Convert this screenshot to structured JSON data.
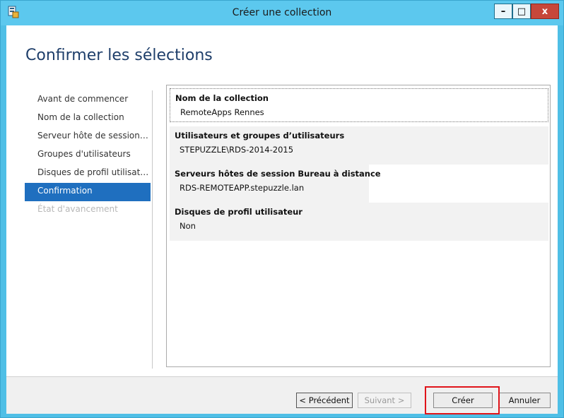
{
  "window": {
    "title": "Créer une collection",
    "minimize_glyph": "–",
    "maximize_glyph": "□",
    "close_glyph": "x",
    "accent_color": "#5cc8ee"
  },
  "page": {
    "title": "Confirmer les sélections"
  },
  "nav": {
    "items": [
      {
        "label": "Avant de commencer",
        "state": "normal"
      },
      {
        "label": "Nom de la collection",
        "state": "normal"
      },
      {
        "label": "Serveur hôte de session Bureau à distance",
        "state": "normal"
      },
      {
        "label": "Groupes d'utilisateurs",
        "state": "normal"
      },
      {
        "label": "Disques de profil utilisateur",
        "state": "normal"
      },
      {
        "label": "Confirmation",
        "state": "active"
      },
      {
        "label": "État d'avancement",
        "state": "disabled"
      }
    ]
  },
  "summary": {
    "sections": [
      {
        "heading": "Nom de la collection",
        "value": "RemoteApps Rennes"
      },
      {
        "heading": "Utilisateurs et groupes d’utilisateurs",
        "value": "STEPUZZLE\\RDS-2014-2015"
      },
      {
        "heading": "Serveurs hôtes de session Bureau à distance",
        "value": "RDS-REMOTEAPP.stepuzzle.lan"
      },
      {
        "heading": "Disques de profil utilisateur",
        "value": "Non"
      }
    ]
  },
  "buttons": {
    "previous": "< Précédent",
    "next": "Suivant >",
    "create": "Créer",
    "cancel": "Annuler"
  }
}
